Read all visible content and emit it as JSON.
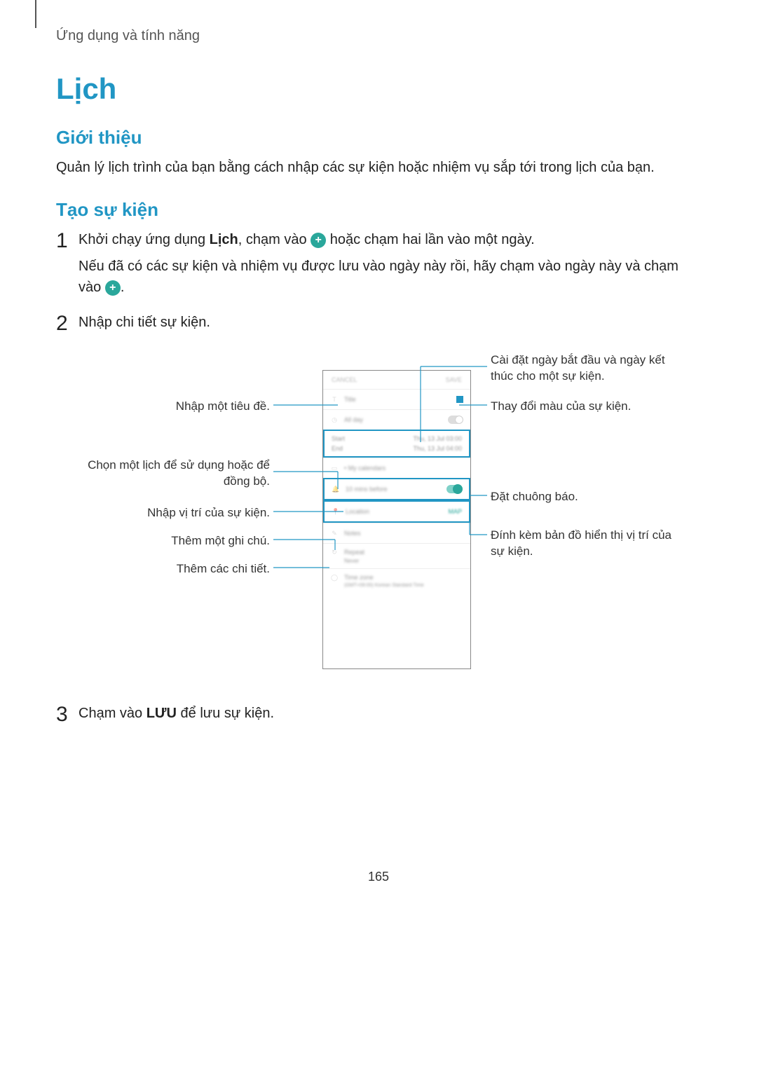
{
  "breadcrumb": "Ứng dụng và tính năng",
  "title": "Lịch",
  "section_intro_title": "Giới thiệu",
  "section_intro_body": "Quản lý lịch trình của bạn bằng cách nhập các sự kiện hoặc nhiệm vụ sắp tới trong lịch của bạn.",
  "section_create_title": "Tạo sự kiện",
  "steps": {
    "s1_num": "1",
    "s1_line1a": "Khởi chạy ứng dụng ",
    "s1_line1b_bold": "Lịch",
    "s1_line1c": ", chạm vào ",
    "s1_line1d": " hoặc chạm hai lần vào một ngày.",
    "s1_line2a": "Nếu đã có các sự kiện và nhiệm vụ được lưu vào ngày này rồi, hãy chạm vào ngày này và chạm vào ",
    "s1_line2b": ".",
    "s2_num": "2",
    "s2_text": "Nhập chi tiết sự kiện.",
    "s3_num": "3",
    "s3_a": "Chạm vào ",
    "s3_b_bold": "LƯU",
    "s3_c": " để lưu sự kiện."
  },
  "callouts": {
    "left_title": "Nhập một tiêu đề.",
    "left_calendar": "Chọn một lịch để sử dụng hoặc để đồng bộ.",
    "left_location": "Nhập vị trí của sự kiện.",
    "left_note": "Thêm một ghi chú.",
    "left_details": "Thêm các chi tiết.",
    "right_dates": "Cài đặt ngày bắt đầu và ngày kết thúc cho một sự kiện.",
    "right_color": "Thay đổi màu của sự kiện.",
    "right_alarm": "Đặt chuông báo.",
    "right_map": "Đính kèm bản đồ hiển thị vị trí của sự kiện."
  },
  "phone": {
    "cancel": "CANCEL",
    "save": "SAVE",
    "title_field": "Title",
    "all_day": "All day",
    "start": "Start",
    "start_val": "Thu, 13 Jul   03:00",
    "end": "End",
    "end_val": "Thu, 13 Jul   04:00",
    "my_cal": "• My calendars",
    "reminder": "10 mins before",
    "location": "Location",
    "map": "MAP",
    "notes": "Notes",
    "repeat": "Repeat",
    "repeat_val": "Never",
    "timezone": "Time zone",
    "timezone_val": "(GMT+09:00) Korean Standard Time"
  },
  "page_number": "165"
}
